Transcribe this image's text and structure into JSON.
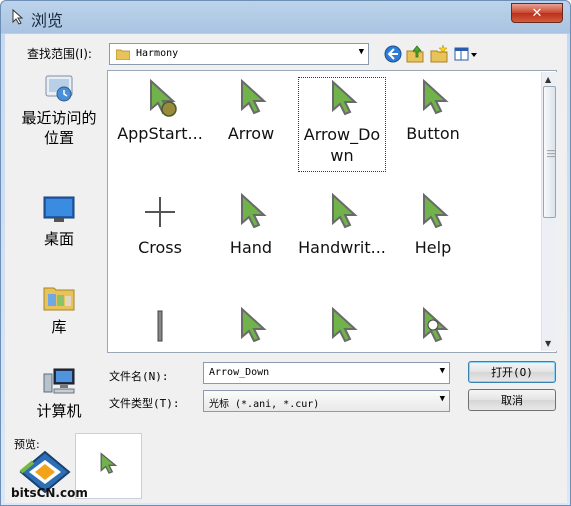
{
  "window": {
    "title": "浏览",
    "close_label": "✕"
  },
  "toolbar": {
    "lookin_label": "查找范围(I):",
    "lookin_value": "Harmony"
  },
  "places": [
    {
      "label": "最近访问的位置",
      "icon": "recent-places-icon"
    },
    {
      "label": "桌面",
      "icon": "desktop-icon"
    },
    {
      "label": "库",
      "icon": "libraries-icon"
    },
    {
      "label": "计算机",
      "icon": "computer-icon"
    }
  ],
  "files": [
    {
      "name": "AppStart...",
      "icon": "cursor-appstarting-icon"
    },
    {
      "name": "Arrow",
      "icon": "cursor-arrow-icon"
    },
    {
      "name": "Arrow_Do wn",
      "icon": "cursor-arrow-icon"
    },
    {
      "name": "Button",
      "icon": "cursor-arrow-icon"
    },
    {
      "name": "Cross",
      "icon": "cursor-cross-icon"
    },
    {
      "name": "Hand",
      "icon": "cursor-arrow-icon"
    },
    {
      "name": "Handwrit...",
      "icon": "cursor-arrow-icon"
    },
    {
      "name": "Help",
      "icon": "cursor-arrow-icon"
    },
    {
      "name": "",
      "icon": "cursor-ibeam-icon"
    },
    {
      "name": "",
      "icon": "cursor-arrow-icon"
    },
    {
      "name": "",
      "icon": "cursor-arrow-icon"
    },
    {
      "name": "",
      "icon": "cursor-busy-icon"
    }
  ],
  "selected_file": "Arrow_Do wn",
  "form": {
    "filename_label": "文件名(N):",
    "filename_value": "Arrow_Down",
    "filetype_label": "文件类型(T):",
    "filetype_value": "光标 (*.ani, *.cur)",
    "open_label": "打开(O)",
    "cancel_label": "取消"
  },
  "preview": {
    "label": "预览:"
  },
  "watermark": {
    "text": "bitsCN.com"
  },
  "colors": {
    "title_bar": "#a9c4e2",
    "close_button": "#c9462f",
    "cursor_green": "#5aa83a",
    "selection_border": "#333333"
  }
}
